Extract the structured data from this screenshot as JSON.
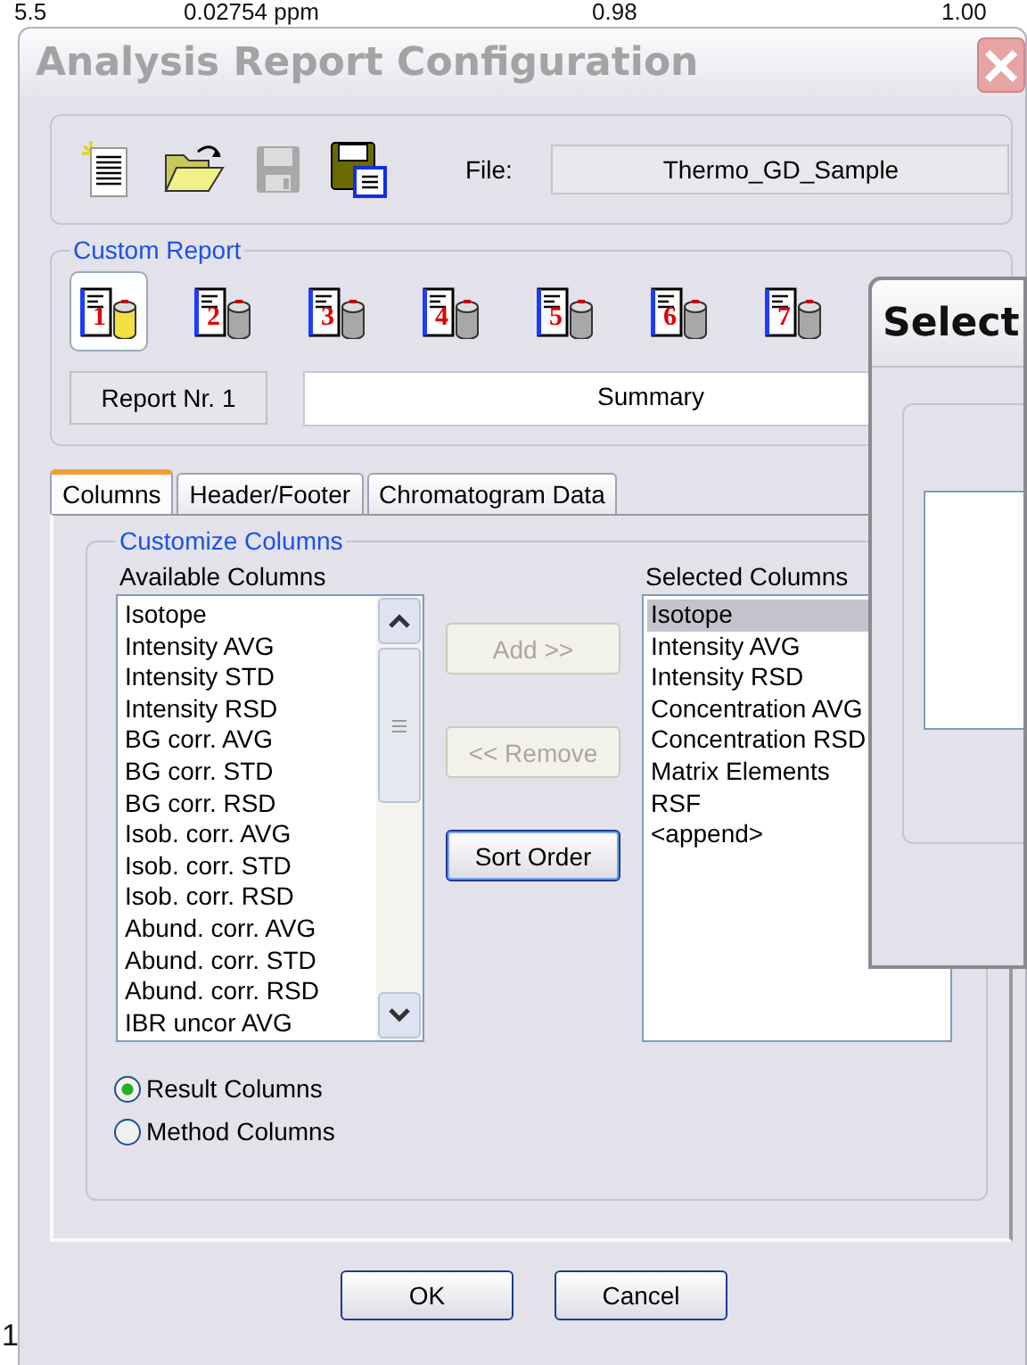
{
  "background_row": [
    "5.5",
    "0.02754 ppm",
    "0.98",
    "1.00"
  ],
  "background_footer": "1",
  "window": {
    "title": "Analysis Report Configuration"
  },
  "toolbar": {
    "buttons": [
      {
        "kind": "new",
        "disabled": false
      },
      {
        "kind": "open",
        "disabled": false
      },
      {
        "kind": "save",
        "disabled": true
      },
      {
        "kind": "save_as",
        "disabled": false
      }
    ],
    "file_label": "File:",
    "file_value": "Thermo_GD_Sample"
  },
  "custom_report": {
    "legend": "Custom Report",
    "reports": [
      {
        "number": "1",
        "selected": true
      },
      {
        "number": "2",
        "selected": false
      },
      {
        "number": "3",
        "selected": false
      },
      {
        "number": "4",
        "selected": false
      },
      {
        "number": "5",
        "selected": false
      },
      {
        "number": "6",
        "selected": false
      },
      {
        "number": "7",
        "selected": false
      }
    ],
    "report_label": "Report Nr. 1",
    "report_name": "Summary"
  },
  "tabs": [
    {
      "label": "Columns",
      "selected": true
    },
    {
      "label": "Header/Footer",
      "selected": false
    },
    {
      "label": "Chromatogram Data",
      "selected": false
    }
  ],
  "customize": {
    "legend": "Customize Columns",
    "available": {
      "label": "Available Columns",
      "items": [
        "Isotope",
        "Intensity AVG",
        "Intensity STD",
        "Intensity RSD",
        "BG corr. AVG",
        "BG corr. STD",
        "BG corr. RSD",
        "Isob. corr. AVG",
        "Isob. corr. STD",
        "Isob. corr. RSD",
        "Abund. corr. AVG",
        "Abund. corr. STD",
        "Abund. corr. RSD",
        "IBR uncor AVG"
      ]
    },
    "buttons": [
      {
        "label": "Add >>",
        "disabled": true
      },
      {
        "label": "<< Remove",
        "disabled": true
      },
      {
        "label": "Sort Order",
        "disabled": false
      }
    ],
    "selected": {
      "label": "Selected Columns",
      "items": [
        {
          "text": "Isotope",
          "selected": true
        },
        {
          "text": "Intensity AVG",
          "selected": false
        },
        {
          "text": "Intensity RSD",
          "selected": false
        },
        {
          "text": "Concentration AVG",
          "selected": false
        },
        {
          "text": "Concentration RSD",
          "selected": false
        },
        {
          "text": "Matrix Elements",
          "selected": false
        },
        {
          "text": "RSF",
          "selected": false
        },
        {
          "text": "<append>",
          "selected": false
        }
      ]
    },
    "radios": [
      {
        "label": "Result Columns",
        "selected": true
      },
      {
        "label": "Method Columns",
        "selected": false
      }
    ]
  },
  "buttons": [
    "OK",
    "Cancel"
  ],
  "select_dialog": {
    "title": "Select"
  }
}
